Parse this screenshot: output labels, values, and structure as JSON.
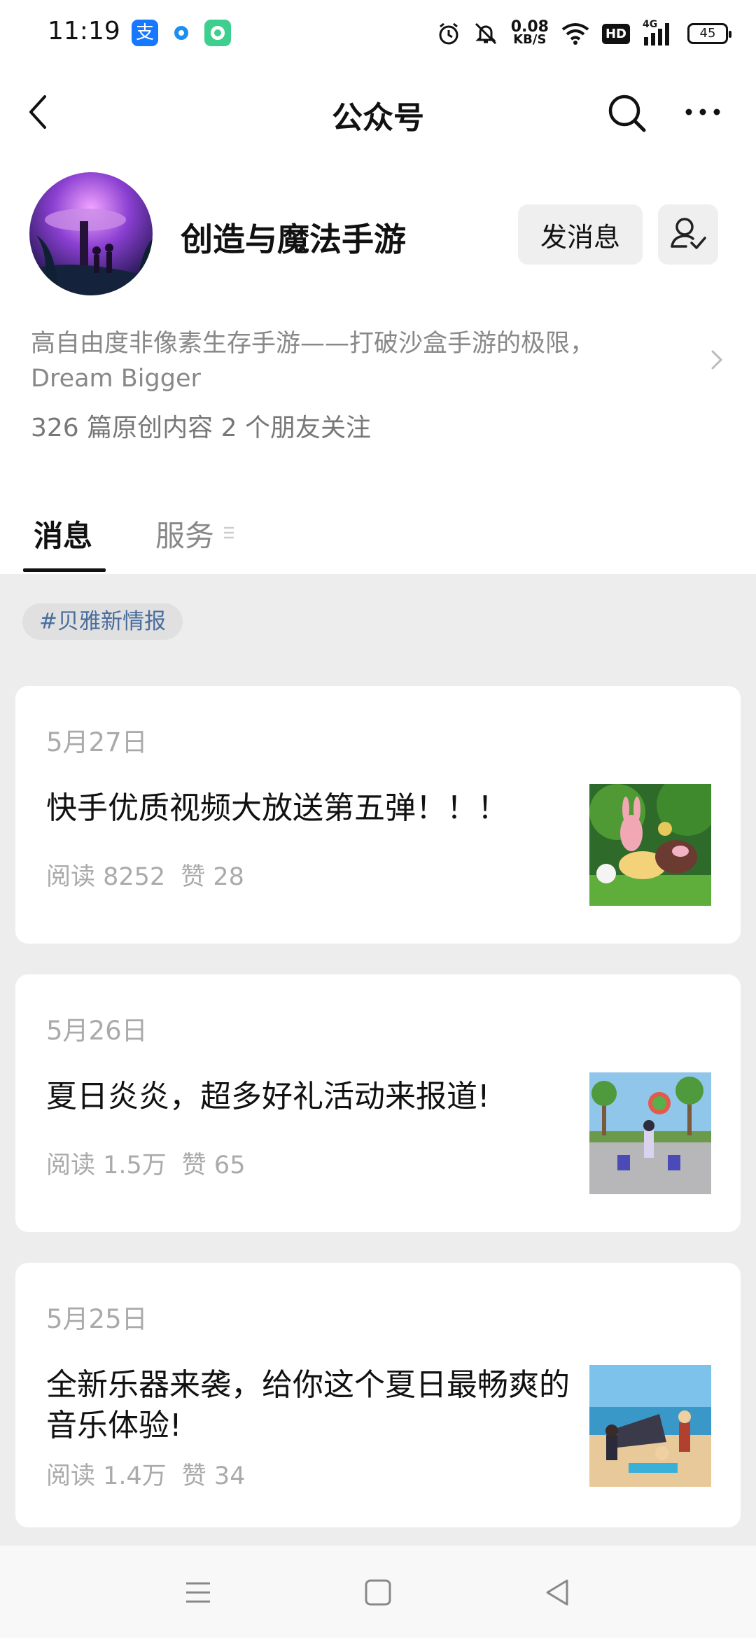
{
  "status_bar": {
    "time": "11:19",
    "alipay_glyph": "支",
    "net_speed_value": "0.08",
    "net_speed_unit": "KB/S",
    "hd_label": "HD",
    "network_label": "4G",
    "battery": "45",
    "icons": [
      "alarm-icon",
      "mute-icon",
      "wifi-icon",
      "signal-icon"
    ]
  },
  "nav": {
    "title": "公众号",
    "icons": [
      "back-icon",
      "search-icon",
      "more-icon"
    ]
  },
  "profile": {
    "name": "创造与魔法手游",
    "message_button": "发消息",
    "description_line1": "高自由度非像素生存手游——打破沙盒手游的极限，",
    "description_line2": "Dream Bigger",
    "stats": "326 篇原创内容  2 个朋友关注"
  },
  "tabs": [
    {
      "label": "消息",
      "active": true
    },
    {
      "label": "服务",
      "active": false
    }
  ],
  "tag": "#贝雅新情报",
  "articles": [
    {
      "date": "5月27日",
      "title": "快手优质视频大放送第五弹！！！",
      "reads": "阅读 8252",
      "likes": "赞 28"
    },
    {
      "date": "5月26日",
      "title": "夏日炎炎，超多好礼活动来报道!",
      "reads": "阅读 1.5万",
      "likes": "赞 65"
    },
    {
      "date": "5月25日",
      "title": "全新乐器来袭，给你这个夏日最畅爽的音乐体验!",
      "reads": "阅读 1.4万",
      "likes": "赞 34"
    }
  ],
  "bottom_nav": [
    "menu-icon",
    "home-icon",
    "back-triangle-icon"
  ],
  "colors": {
    "accent_link": "#4a6d9c",
    "page_bg": "#ededed",
    "alipay_blue": "#1677ff"
  }
}
